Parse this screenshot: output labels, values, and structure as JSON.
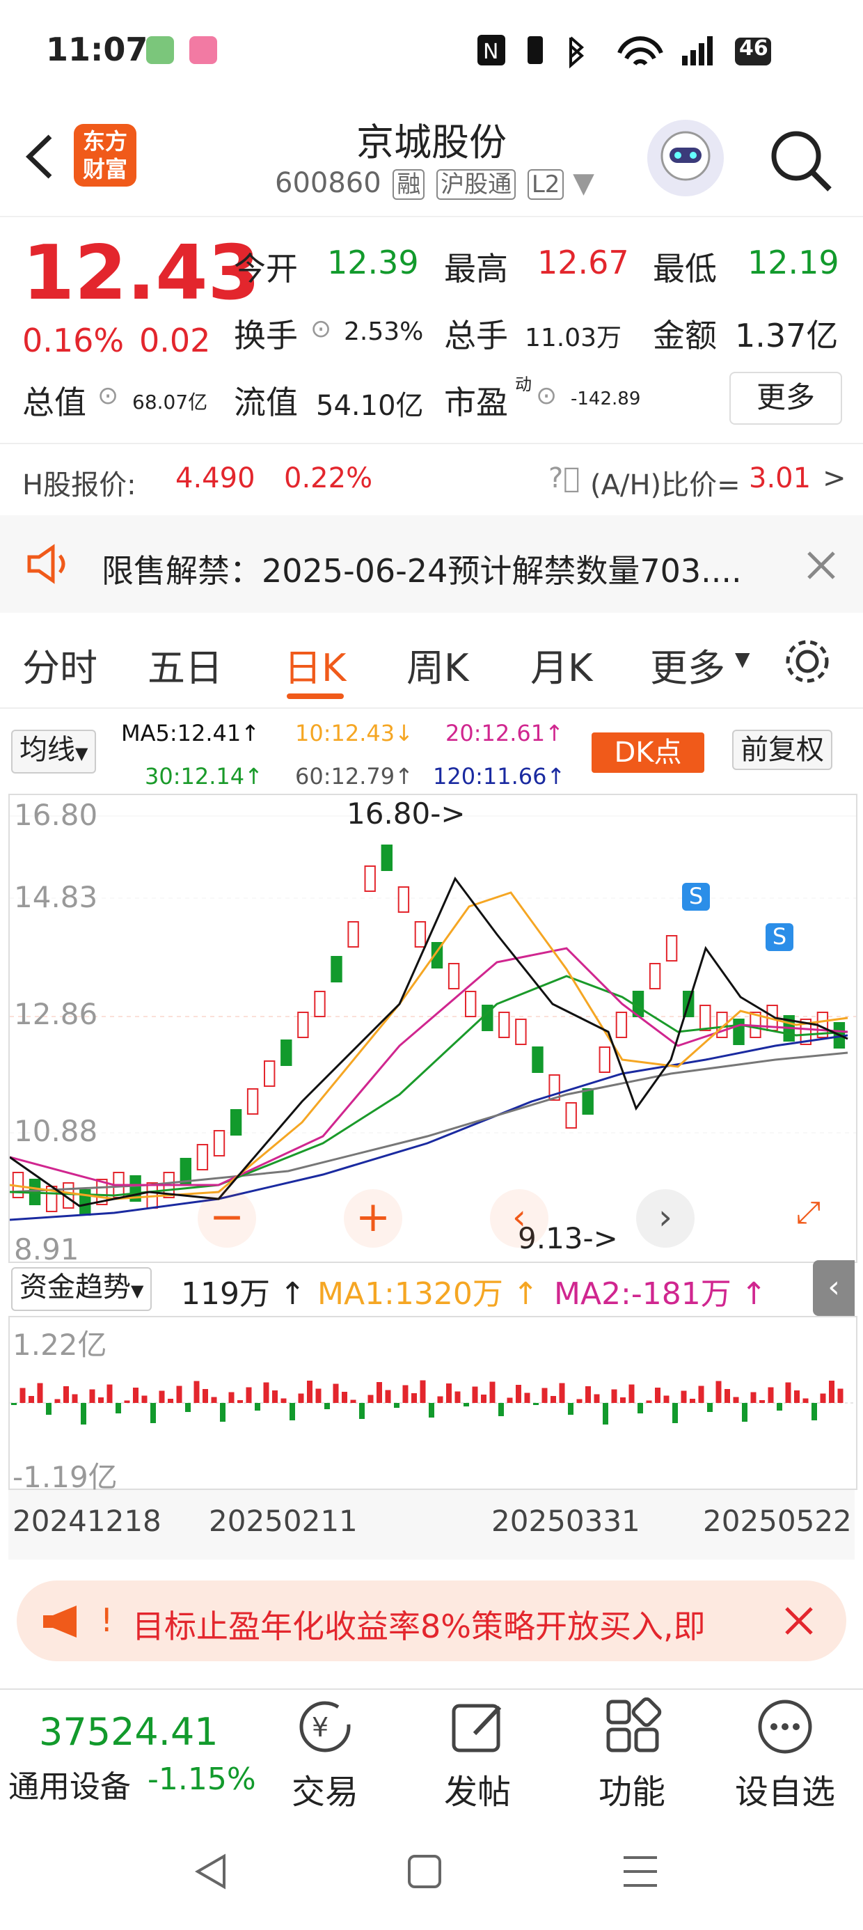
{
  "status": {
    "time": "11:07",
    "battery": "46"
  },
  "stock": {
    "name": "京城股份",
    "code": "600860",
    "tags": [
      "融",
      "沪股通",
      "L2"
    ]
  },
  "logo": {
    "line1": "东方",
    "line2": "财富"
  },
  "quote": {
    "price": "12.43",
    "change_pct": "0.16%",
    "change": "0.02",
    "open_label": "今开",
    "open": "12.39",
    "high_label": "最高",
    "high": "12.67",
    "low_label": "最低",
    "low": "12.19",
    "turnover_label": "换手",
    "turnover": "2.53%",
    "volume_label": "总手",
    "volume": "11.03万",
    "amount_label": "金额",
    "amount": "1.37亿",
    "mktcap_label": "总值",
    "mktcap": "68.07亿",
    "float_label": "流值",
    "float": "54.10亿",
    "pe_label": "市盈",
    "pe_sup": "动",
    "pe": "-142.89",
    "more": "更多"
  },
  "hshare": {
    "label": "H股报价:",
    "price": "4.490",
    "pct": "0.22%",
    "ah_label": "(A/H)比价=",
    "ah_value": "3.01",
    "arrow": ">"
  },
  "notice": {
    "text": "限售解禁：2025-06-24预计解禁数量703...."
  },
  "tabs": [
    "分时",
    "五日",
    "日K",
    "周K",
    "月K",
    "更多"
  ],
  "active_tab": "日K",
  "ma": {
    "selector": "均线",
    "ma5": "MA5:12.41↑",
    "ma10": "10:12.43↓",
    "ma20": "20:12.61↑",
    "ma30": "30:12.14↑",
    "ma60": "60:12.79↑",
    "ma120": "120:11.66↑",
    "dk": "DK点",
    "fq": "前复权"
  },
  "kline": {
    "ymax": "16.80",
    "y2": "14.83",
    "y3": "12.86",
    "y4": "10.88",
    "ymin": "8.91",
    "high_marker": "16.80->",
    "low_marker": "9.13->"
  },
  "flow": {
    "selector": "资金趋势",
    "value": "119万",
    "value_arrow": "↑",
    "ma1": "MA1:1320万",
    "ma1_arrow": "↑",
    "ma2": "MA2:-181万",
    "ma2_arrow": "↑",
    "ymax": "1.22亿",
    "ymin": "-1.19亿"
  },
  "dates": [
    "20241218",
    "20250211",
    "20250331",
    "20250522"
  ],
  "banner": {
    "text": "目标止盈年化收益率8%策略开放买入,即"
  },
  "bottom": {
    "index_value": "37524.41",
    "index_name": "通用设备",
    "index_pct": "-1.15%",
    "items": [
      "交易",
      "发帖",
      "功能",
      "设自选"
    ]
  },
  "colors": {
    "up": "#e3262d",
    "down": "#129a2c",
    "accent": "#f05a1a",
    "ma5": "#111111",
    "ma10": "#f5a623",
    "ma20": "#d0268f",
    "ma30": "#1a9a2a",
    "ma60": "#777777",
    "ma120": "#1a2aa0"
  }
}
